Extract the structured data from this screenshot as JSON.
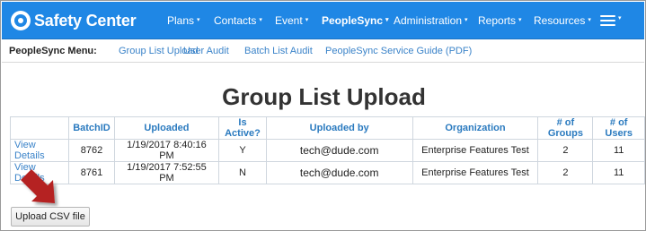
{
  "brand": {
    "name": "Safety Center"
  },
  "nav": {
    "items": [
      {
        "label": "Plans"
      },
      {
        "label": "Contacts"
      },
      {
        "label": "Event"
      },
      {
        "label": "PeopleSync"
      },
      {
        "label": "Administration"
      },
      {
        "label": "Reports"
      },
      {
        "label": "Resources"
      }
    ],
    "caret": "▾"
  },
  "submenu": {
    "label": "PeopleSync Menu:",
    "links": [
      {
        "label": "Group List Upload"
      },
      {
        "label": "User Audit"
      },
      {
        "label": "Batch List Audit"
      },
      {
        "label": "PeopleSync Service Guide (PDF)"
      }
    ]
  },
  "page": {
    "title": "Group List Upload"
  },
  "table": {
    "headers": [
      "",
      "BatchID",
      "Uploaded",
      "Is Active?",
      "Uploaded by",
      "Organization",
      "# of Groups",
      "# of Users"
    ],
    "rows": [
      {
        "action": "View Details",
        "batch_id": "8762",
        "uploaded": "1/19/2017 8:40:16 PM",
        "active": "Y",
        "uploaded_by": "tech@dude.com",
        "organization": "Enterprise Features Test",
        "groups": "2",
        "users": "11"
      },
      {
        "action": "View Details",
        "batch_id": "8761",
        "uploaded": "1/19/2017 7:52:55 PM",
        "active": "N",
        "uploaded_by": "tech@dude.com",
        "organization": "Enterprise Features Test",
        "groups": "2",
        "users": "11"
      }
    ]
  },
  "upload_button": {
    "label": "Upload CSV file"
  },
  "colors": {
    "navbar": "#1f87e5",
    "link": "#3a83c9",
    "header_text": "#2a7abf",
    "arrow": "#b52020"
  }
}
